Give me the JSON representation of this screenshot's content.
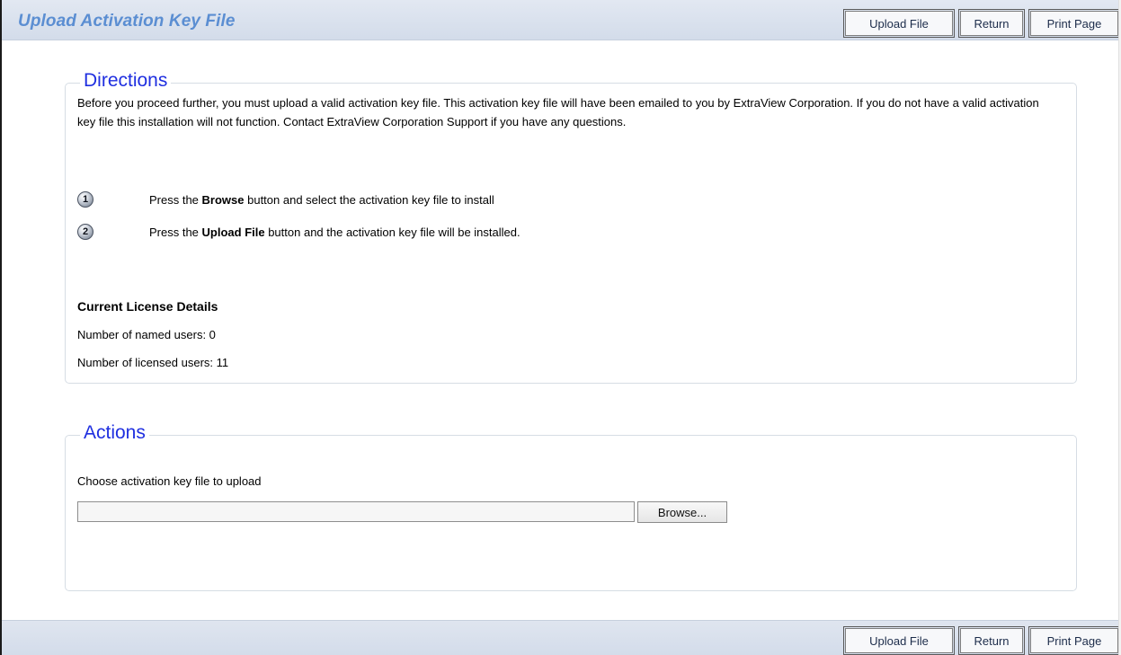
{
  "header": {
    "title": "Upload Activation Key File",
    "buttons": [
      "Upload File",
      "Return",
      "Print Page"
    ]
  },
  "directions": {
    "legend": "Directions",
    "intro": "Before you proceed further, you must upload a valid activation key file. This activation key file will have been emailed to you by ExtraView Corporation. If you do not have a valid activation key file this installation will not function. Contact ExtraView Corporation Support if you have any questions.",
    "steps": [
      {
        "number": "1",
        "before": "Press the ",
        "bold": "Browse",
        "after": " button and select the activation key file to install"
      },
      {
        "number": "2",
        "before": "Press the ",
        "bold": "Upload File",
        "after": " button and the activation key file will be installed."
      }
    ],
    "license_heading": "Current License Details",
    "named_users": "Number of named users: 0",
    "licensed_users": "Number of licensed users: 11"
  },
  "actions": {
    "legend": "Actions",
    "file_label": "Choose activation key file to upload",
    "file_value": "",
    "browse_label": "Browse..."
  },
  "footer": {
    "buttons": [
      "Upload File",
      "Return",
      "Print Page"
    ]
  },
  "colors": {
    "title": "#5b8ed2",
    "legend": "#1f2fe0",
    "bar": "#d3dcea"
  }
}
